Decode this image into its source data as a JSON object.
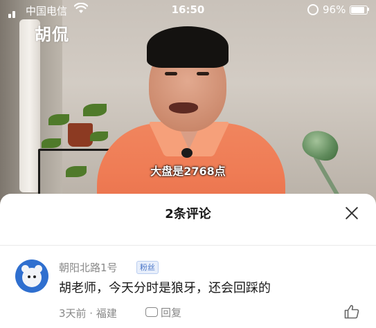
{
  "status_bar": {
    "carrier": "中国电信",
    "time": "16:50",
    "battery_percent": "96%",
    "battery_level": 0.96,
    "icons": [
      "signal-icon",
      "wifi-icon",
      "orientation-lock-icon",
      "battery-icon"
    ]
  },
  "video": {
    "logo_text": "胡侃",
    "subtitle": "大盘是2768点"
  },
  "comments_sheet": {
    "title": "2条评论",
    "close_icon": "close-icon",
    "comments": [
      {
        "username": "朝阳北路1号",
        "badge": "粉丝",
        "text": "胡老师，今天分时是狼牙，还会回踩的",
        "meta": "3天前 · 福建",
        "reply_label": "回复",
        "avatar_icon": "bear-avatar",
        "like_icon": "thumbs-up-icon"
      }
    ]
  },
  "colors": {
    "sheet_bg": "#ffffff",
    "text_primary": "#1a1a1a",
    "text_secondary": "#888888",
    "badge_blue": "#4a76c8",
    "avatar_blue": "#2f6fcf"
  }
}
